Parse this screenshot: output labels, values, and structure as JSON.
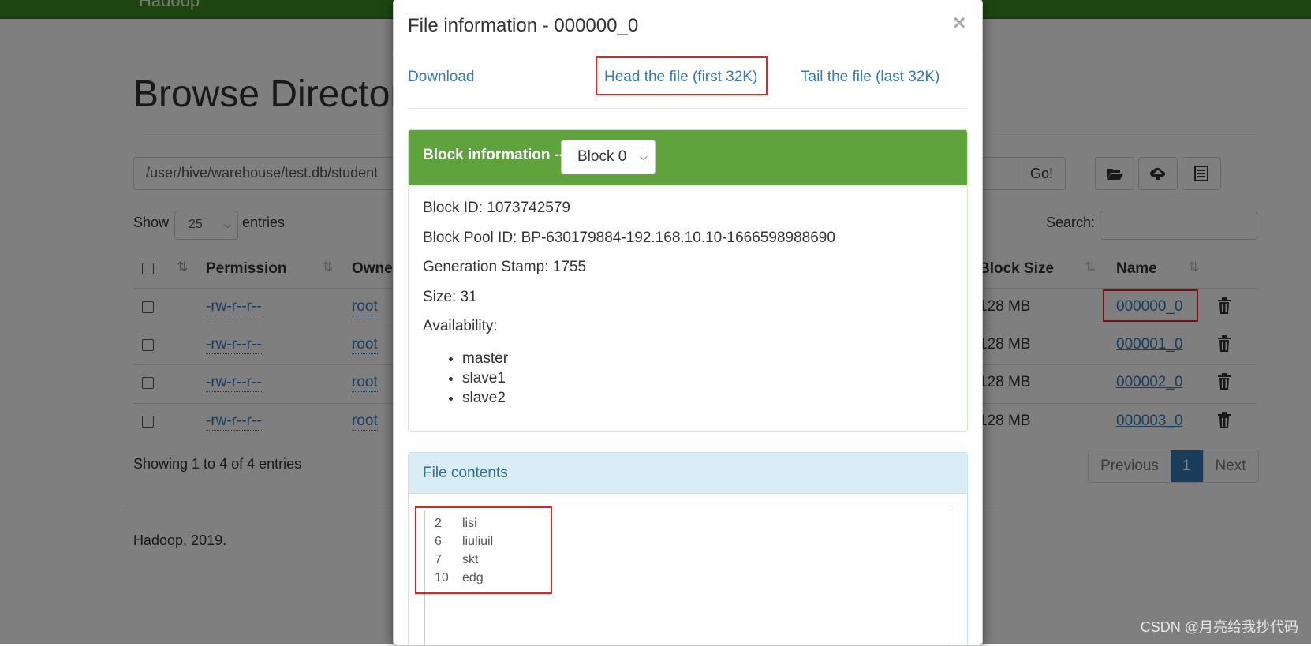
{
  "background": {
    "brand": "Hadoop",
    "title": "Browse Directory",
    "path_value": "/user/hive/warehouse/test.db/student",
    "go_label": "Go!",
    "toolbar_icons": [
      "folder-open-icon",
      "cloud-upload-icon",
      "list-icon"
    ],
    "show_label": "Show",
    "entries_value": "25",
    "entries_label": "entries",
    "search_label": "Search:",
    "columns": {
      "permission": "Permission",
      "owner": "Owner",
      "block_size": "Block Size",
      "name": "Name"
    },
    "rows": [
      {
        "permission": "-rw-r--r--",
        "owner": "root",
        "block_size": "128 MB",
        "name": "000000_0"
      },
      {
        "permission": "-rw-r--r--",
        "owner": "root",
        "block_size": "128 MB",
        "name": "000001_0"
      },
      {
        "permission": "-rw-r--r--",
        "owner": "root",
        "block_size": "128 MB",
        "name": "000002_0"
      },
      {
        "permission": "-rw-r--r--",
        "owner": "root",
        "block_size": "128 MB",
        "name": "000003_0"
      }
    ],
    "showing_text": "Showing 1 to 4 of 4 entries",
    "pager": {
      "previous": "Previous",
      "page": "1",
      "next": "Next"
    },
    "footer": "Hadoop, 2019."
  },
  "modal": {
    "title": "File information - 000000_0",
    "close": "×",
    "download": "Download",
    "head": "Head the file (first 32K)",
    "tail": "Tail the file (last 32K)",
    "block_info_label": "Block information --",
    "block_select_value": "Block 0",
    "block_id": "Block ID: 1073742579",
    "block_pool_id": "Block Pool ID: BP-630179884-192.168.10.10-1666598988690",
    "generation_stamp": "Generation Stamp: 1755",
    "size": "Size: 31",
    "availability_label": "Availability:",
    "availability": [
      "master",
      "slave1",
      "slave2"
    ],
    "file_contents_label": "File contents",
    "file_contents": [
      {
        "id": "2",
        "name": "lisi"
      },
      {
        "id": "6",
        "name": "liuliuil"
      },
      {
        "id": "7",
        "name": "skt"
      },
      {
        "id": "10",
        "name": "edg"
      }
    ]
  },
  "watermark": "CSDN @月亮给我抄代码",
  "colors": {
    "navbar": "#3c8b1f",
    "panel_green": "#5ea33c",
    "link": "#337ab7",
    "highlight_red": "#e02424",
    "info_panel": "#d9edf7"
  }
}
